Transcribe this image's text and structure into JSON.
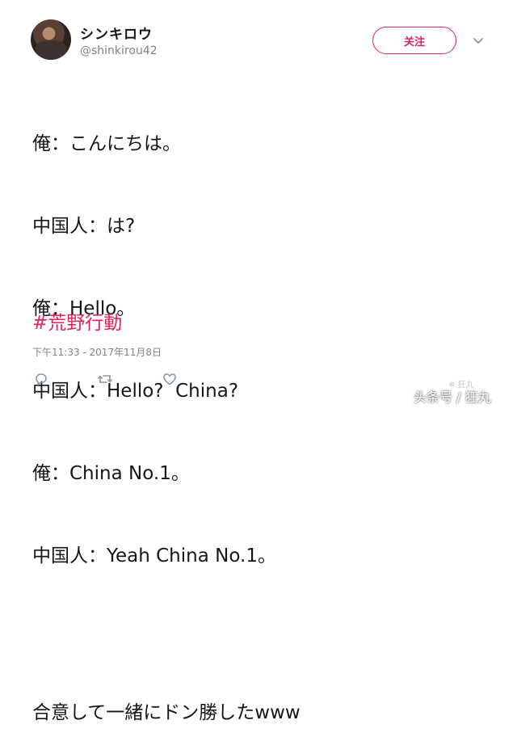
{
  "user": {
    "display_name": "シンキロウ",
    "handle": "@shinkirou42"
  },
  "follow_button_label": "关注",
  "tweet": {
    "lines": [
      "俺：こんにちは。",
      "中国人：は?",
      "俺：Hello。",
      "中国人：Hello?  China?",
      "俺：China No.1。",
      "中国人：Yeah China No.1。",
      "",
      "合意して一緒にドン勝したwww"
    ],
    "hashtag": "#荒野行動",
    "timestamp": "下午11:33 - 2017年11月8日"
  },
  "actions": [
    "reply-icon",
    "retweet-icon",
    "like-icon"
  ],
  "watermark": {
    "small": "※ 狂丸",
    "main": "头条号 / 狂丸"
  },
  "colors": {
    "accent": "#e0245e",
    "secondary_text": "#7a848c"
  }
}
